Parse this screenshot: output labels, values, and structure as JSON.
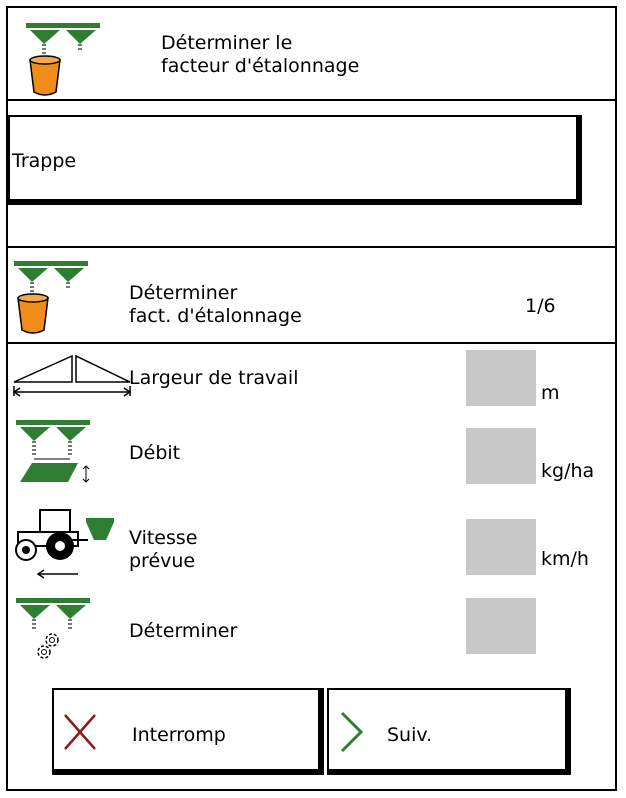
{
  "header": {
    "title": "Déterminer le\nfacteur d'étalonnage"
  },
  "selection": {
    "value": "Trappe"
  },
  "section": {
    "title": "Déterminer\nfact. d'étalonnage",
    "page": "1/6"
  },
  "rows": [
    {
      "label": "Largeur de travail",
      "unit": "m",
      "icon": "working-width-icon"
    },
    {
      "label": "Débit",
      "unit": "kg/ha",
      "icon": "application-rate-icon"
    },
    {
      "label": "Vitesse\nprévue",
      "unit": "km/h",
      "icon": "tractor-speed-icon"
    },
    {
      "label": "Déterminer",
      "unit": "",
      "icon": "spreader-gears-icon"
    }
  ],
  "buttons": {
    "cancel": {
      "label": "Interromp",
      "icon": "cross-icon"
    },
    "next": {
      "label": "Suiv.",
      "icon": "chevron-right-icon"
    }
  },
  "colors": {
    "green": "#2e7d32",
    "orange": "#f08c1a",
    "field": "#c8c8c8",
    "cross": "#8b1a1a"
  }
}
